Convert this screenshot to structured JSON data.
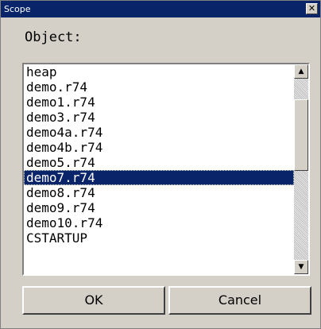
{
  "window": {
    "title": "Scope",
    "close_glyph": "✕"
  },
  "object_label": "Object:",
  "list": {
    "items": [
      "heap",
      "demo.r74",
      "demo1.r74",
      "demo3.r74",
      "demo4a.r74",
      "demo4b.r74",
      "demo5.r74",
      "demo7.r74",
      "demo8.r74",
      "demo9.r74",
      "demo10.r74",
      "CSTARTUP"
    ],
    "selected_index": 7
  },
  "scrollbar": {
    "up_glyph": "▲",
    "down_glyph": "▼"
  },
  "buttons": {
    "ok": "OK",
    "cancel": "Cancel"
  },
  "colors": {
    "titlebar": "#0a246a",
    "selection": "#0a246a",
    "dialog_bg": "#d4d0c8"
  }
}
